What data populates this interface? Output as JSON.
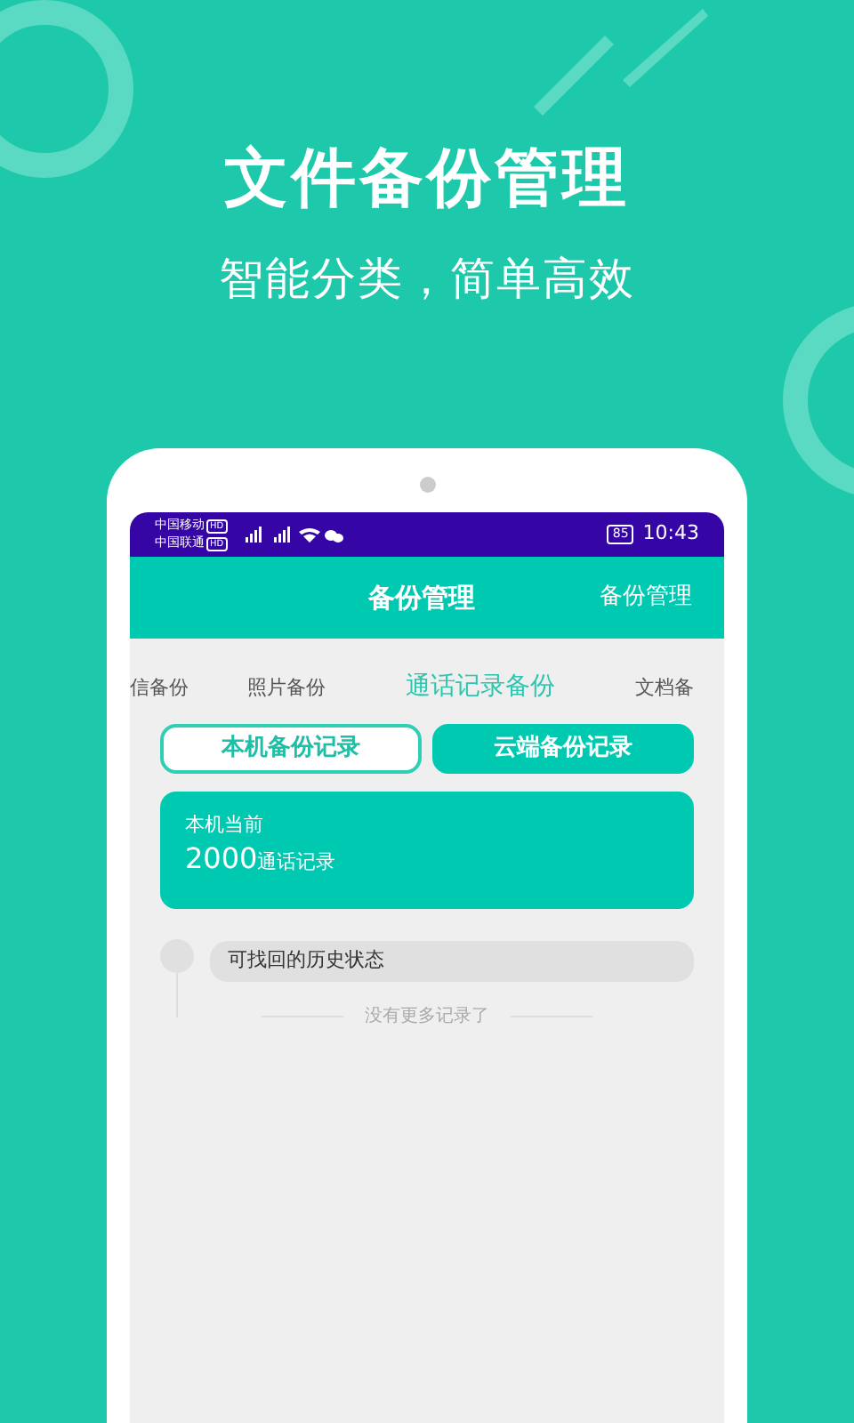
{
  "promo": {
    "title": "文件备份管理",
    "subtitle": "智能分类，简单高效"
  },
  "status_bar": {
    "carriers": [
      {
        "name": "中国移动",
        "badge": "HD"
      },
      {
        "name": "中国联通",
        "badge": "HD"
      }
    ],
    "battery": "85",
    "time": "10:43"
  },
  "app_bar": {
    "title": "备份管理",
    "action": "备份管理"
  },
  "tabs": [
    {
      "label": "信备份",
      "selected": false
    },
    {
      "label": "照片备份",
      "selected": false
    },
    {
      "label": "通话记录备份",
      "selected": true
    },
    {
      "label": "文档备",
      "selected": false
    }
  ],
  "toggles": [
    {
      "label": "本机备份记录",
      "selected": false
    },
    {
      "label": "云端备份记录",
      "selected": true
    }
  ],
  "summary": {
    "caption": "本机当前",
    "count": "2000",
    "unit": "通话记录"
  },
  "timeline": [
    {
      "label": "可找回的历史状态"
    }
  ],
  "footer_note": "没有更多记录了"
}
